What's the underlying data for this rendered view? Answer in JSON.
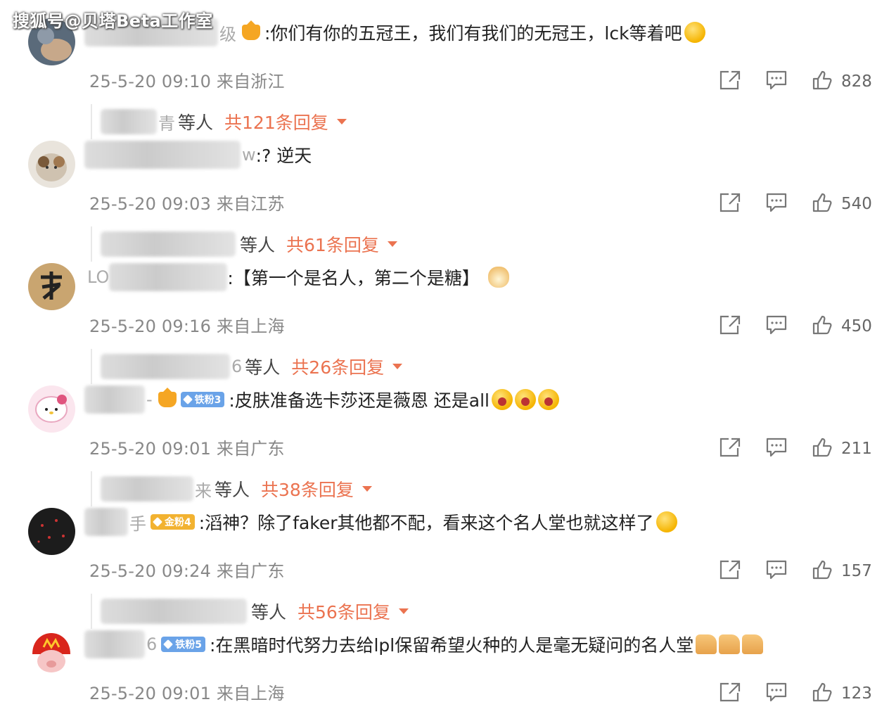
{
  "watermark": "搜狐号@贝塔Beta工作室",
  "comments": [
    {
      "name_tail": "级",
      "text": ":你们有你的五冠王，我们有我们的无冠王，lck等着吧",
      "meta": "25-5-20 09:10 来自浙江",
      "likes": "828",
      "reply_name_tail": "青",
      "reply_who": "等人",
      "reply_total": "共121条回复"
    },
    {
      "name_tail": "w",
      "text": ":? 逆天",
      "meta": "25-5-20 09:03 来自江苏",
      "likes": "540",
      "reply_name_tail": "",
      "reply_who": "等人",
      "reply_total": "共61条回复"
    },
    {
      "name_tail": "LO",
      "text": ":【第一个是名人，第二个是糖】",
      "meta": "25-5-20 09:16 来自上海",
      "likes": "450",
      "reply_name_tail": "6",
      "reply_who": "等人",
      "reply_total": "共26条回复"
    },
    {
      "name_tail": "-",
      "fan_badge": "铁粉3",
      "text": ":皮肤准备选卡莎还是薇恩 还是all",
      "meta": "25-5-20 09:01 来自广东",
      "likes": "211",
      "reply_name_tail": "来",
      "reply_who": "等人",
      "reply_total": "共38条回复"
    },
    {
      "name_tail": "手",
      "fan_badge": "金粉4",
      "text": ":滔神？除了faker其他都不配，看来这个名人堂也就这样了",
      "meta": "25-5-20 09:24 来自广东",
      "likes": "157",
      "reply_name_tail": "",
      "reply_who": "等人",
      "reply_total": "共56条回复"
    },
    {
      "name_tail": "6",
      "fan_badge": "铁粉5",
      "text": ":在黑暗时代努力去给lpl保留希望火种的人是毫无疑问的名人堂",
      "meta": "25-5-20 09:01 来自上海",
      "likes": "123"
    }
  ],
  "icons": {
    "share": "share-icon",
    "comment": "comment-icon",
    "like": "thumbs-up-icon"
  },
  "colors": {
    "reply_accent": "#eb7350",
    "meta_gray": "#888888"
  }
}
